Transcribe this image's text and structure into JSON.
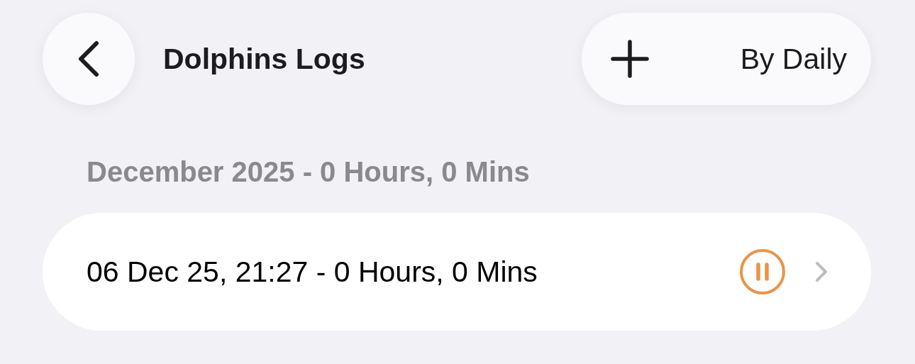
{
  "header": {
    "title": "Dolphins Logs",
    "filter_button": {
      "label": "By Daily"
    }
  },
  "sections": [
    {
      "title": "December 2025 - 0 Hours, 0 Mins",
      "entries": [
        {
          "label": "06 Dec 25, 21:27 - 0 Hours, 0 Mins",
          "running": true
        }
      ]
    }
  ]
}
